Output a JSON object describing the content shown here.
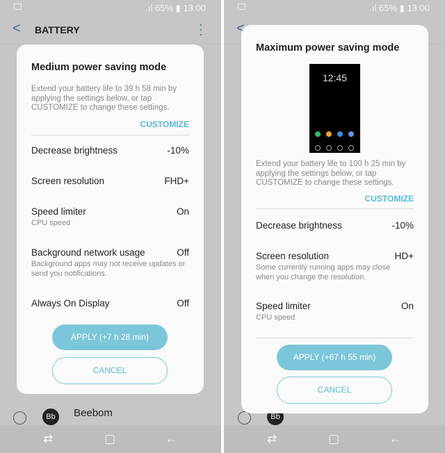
{
  "status": {
    "battery": "65%",
    "time": "13:00"
  },
  "header": {
    "title": "BATTERY"
  },
  "background": {
    "app_name": "Beebom",
    "app_initials": "Bb"
  },
  "left_dialog": {
    "title": "Medium power saving mode",
    "description": "Extend your battery life to 39 h 58 min by applying the settings below, or tap CUSTOMIZE to change these settings.",
    "customize": "CUSTOMIZE",
    "rows": [
      {
        "label": "Decrease brightness",
        "value": "-10%"
      },
      {
        "label": "Screen resolution",
        "value": "FHD+"
      },
      {
        "label": "Speed limiter",
        "value": "On",
        "sub": "CPU speed"
      },
      {
        "label": "Background network usage",
        "value": "Off",
        "sub": "Background apps may not receive updates or send you notifications."
      },
      {
        "label": "Always On Display",
        "value": "Off"
      }
    ],
    "apply": "APPLY (+7 h 28 min)",
    "cancel": "CANCEL"
  },
  "right_dialog": {
    "title": "Maximum power saving mode",
    "preview_time": "12:45",
    "description": "Extend your battery life to 100 h 25 min by applying the settings below, or tap CUSTOMIZE to change these settings.",
    "customize": "CUSTOMIZE",
    "rows": [
      {
        "label": "Decrease brightness",
        "value": "-10%"
      },
      {
        "label": "Screen resolution",
        "value": "HD+",
        "sub": "Some currently running apps may close when you change the resolution."
      },
      {
        "label": "Speed limiter",
        "value": "On",
        "sub": "CPU speed"
      }
    ],
    "apply": "APPLY (+67 h 55 min)",
    "cancel": "CANCEL"
  },
  "colors": {
    "accent": "#7cc6da",
    "accent_text": "#57bbd2",
    "scrim": "#c6c6c6"
  }
}
